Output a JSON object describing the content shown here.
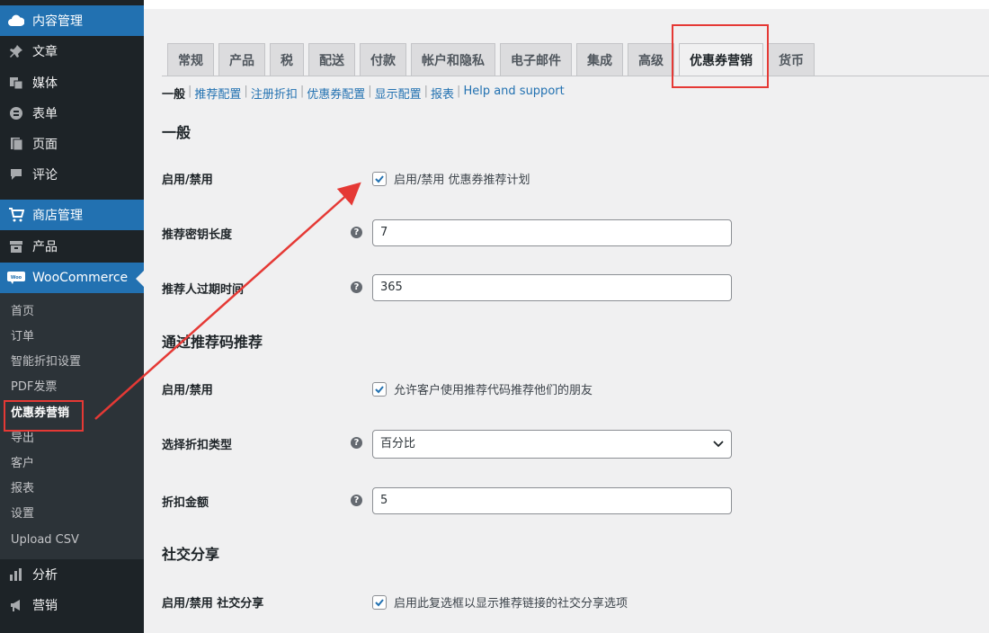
{
  "sidebar": {
    "items": [
      {
        "label": "内容管理",
        "icon": "cloud-icon"
      },
      {
        "label": "文章",
        "icon": "pin-icon"
      },
      {
        "label": "媒体",
        "icon": "media-icon"
      },
      {
        "label": "表单",
        "icon": "form-icon"
      },
      {
        "label": "页面",
        "icon": "page-icon"
      },
      {
        "label": "评论",
        "icon": "comment-icon"
      },
      {
        "label": "商店管理",
        "icon": "cart-icon"
      },
      {
        "label": "产品",
        "icon": "archive-icon"
      },
      {
        "label": "WooCommerce",
        "icon": "woo-icon"
      },
      {
        "label": "分析",
        "icon": "bar-chart-icon"
      },
      {
        "label": "营销",
        "icon": "megaphone-icon"
      }
    ],
    "submenu": [
      "首页",
      "订单",
      "智能折扣设置",
      "PDF发票",
      "优惠券营销",
      "导出",
      "客户",
      "报表",
      "设置",
      "Upload CSV"
    ]
  },
  "tabs": [
    "常规",
    "产品",
    "税",
    "配送",
    "付款",
    "帐户和隐私",
    "电子邮件",
    "集成",
    "高级",
    "优惠券营销",
    "货币"
  ],
  "subsub": [
    "一般",
    "推荐配置",
    "注册折扣",
    "优惠券配置",
    "显示配置",
    "报表",
    "Help and support"
  ],
  "sections": {
    "general": {
      "title": "一般",
      "enable_label": "启用/禁用",
      "enable_text": "启用/禁用 优惠券推荐计划",
      "key_length_label": "推荐密钥长度",
      "key_length_value": "7",
      "expiry_label": "推荐人过期时间",
      "expiry_value": "365"
    },
    "referral_code": {
      "title": "通过推荐码推荐",
      "enable_label": "启用/禁用",
      "enable_text": "允许客户使用推荐代码推荐他们的朋友",
      "discount_type_label": "选择折扣类型",
      "discount_type_value": "百分比",
      "amount_label": "折扣金额",
      "amount_value": "5"
    },
    "social": {
      "title": "社交分享",
      "enable_label": "启用/禁用 社交分享",
      "enable_text": "启用此复选框以显示推荐链接的社交分享选项"
    }
  },
  "colors": {
    "accent": "#2271b1",
    "annotation": "#e53935"
  }
}
